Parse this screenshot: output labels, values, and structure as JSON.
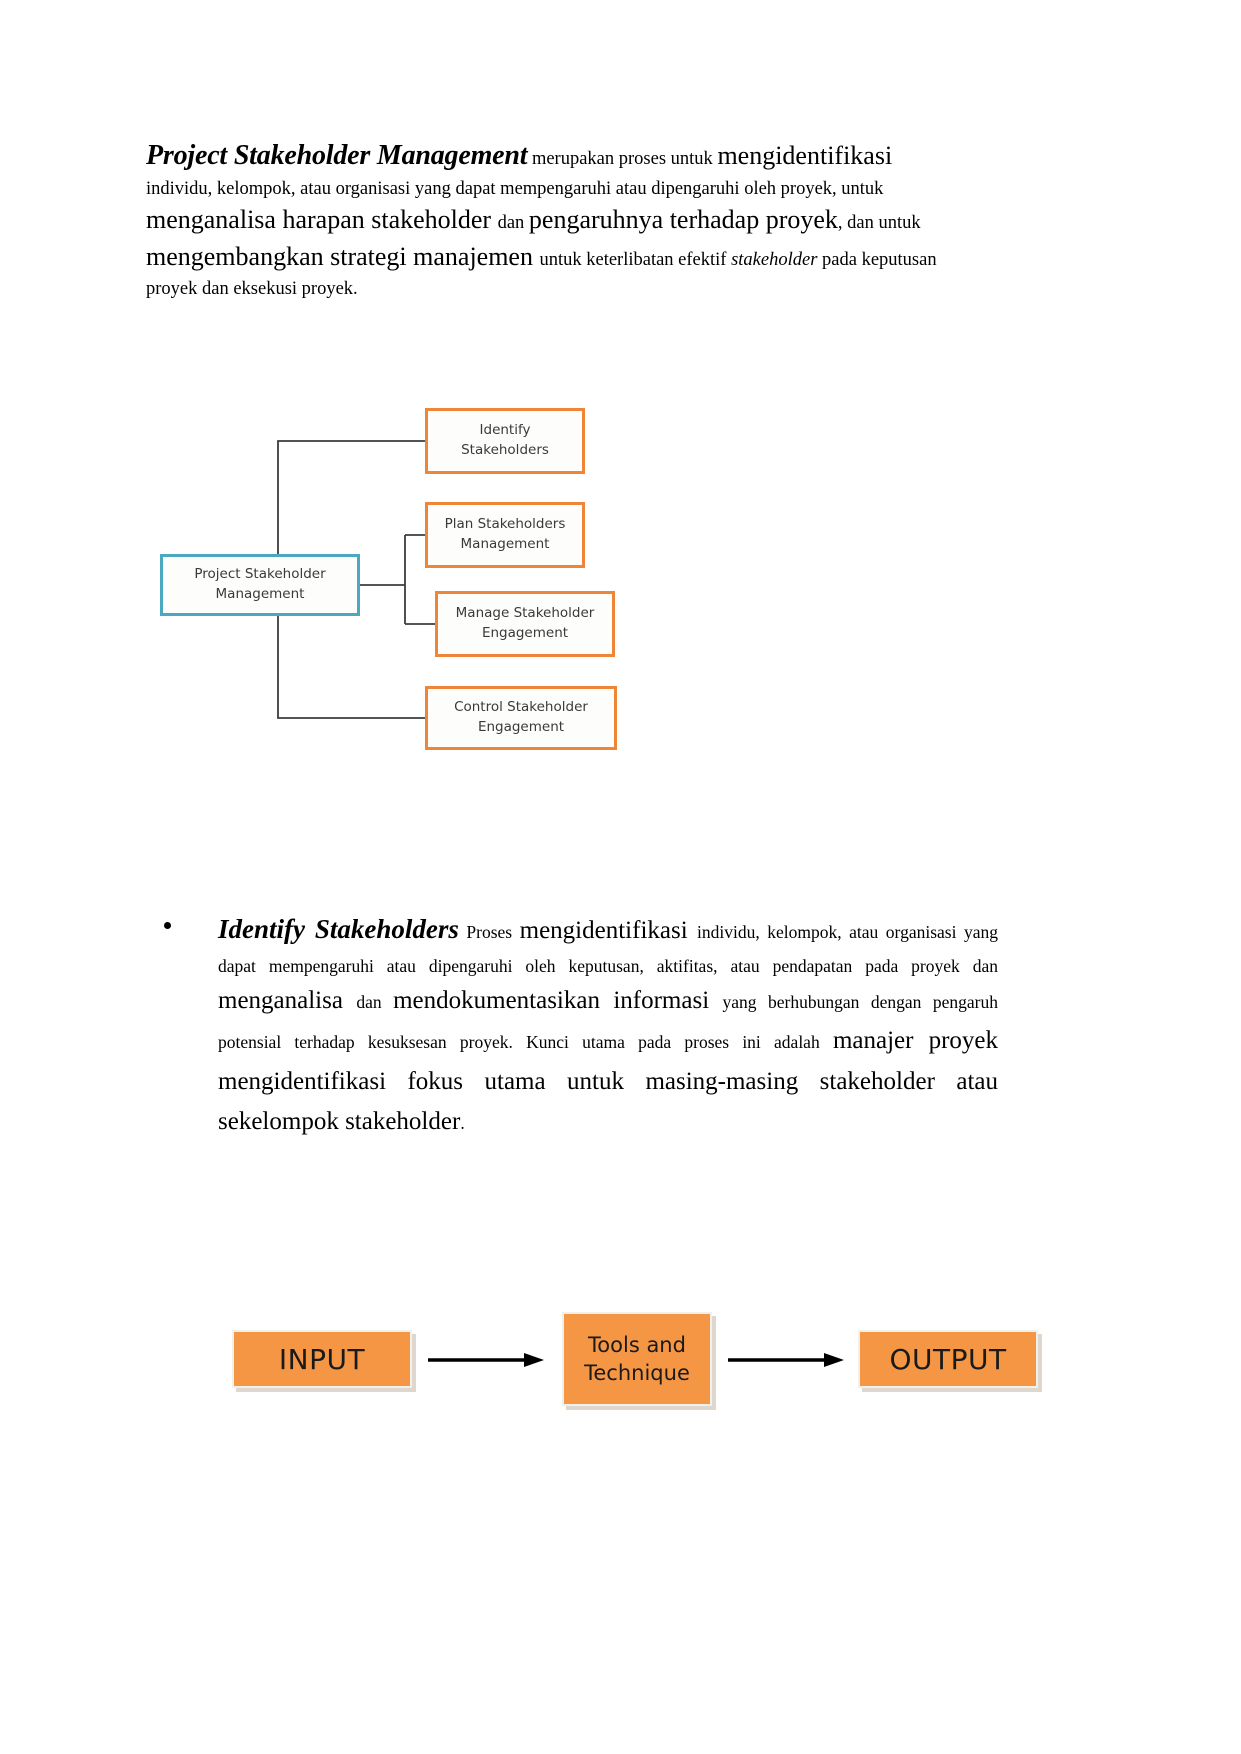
{
  "document": {
    "intro_paragraph": {
      "segments": [
        {
          "text": "Project Stakeholder Management",
          "style": "hero"
        },
        {
          "text": " merupakan proses untuk ",
          "style": "sm"
        },
        {
          "text": "mengidentifikasi ",
          "style": "lg"
        },
        {
          "text": "individu, kelompok, atau organisasi yang dapat mempengaruhi atau dipengaruhi oleh proyek, untuk ",
          "style": "sm"
        },
        {
          "text": "menganalisa harapan stakeholder ",
          "style": "lg"
        },
        {
          "text": "dan ",
          "style": "sm"
        },
        {
          "text": "pengaruhnya terhadap proyek",
          "style": "lg"
        },
        {
          "text": ", dan untuk ",
          "style": "sm"
        },
        {
          "text": "mengembangkan strategi manajemen ",
          "style": "lg"
        },
        {
          "text": "untuk keterlibatan efektif ",
          "style": "sm"
        },
        {
          "text": "stakeholder",
          "style": "it"
        },
        {
          "text": " pada keputusan proyek dan eksekusi proyek.",
          "style": "sm"
        }
      ]
    },
    "org_diagram": {
      "root_label_line1": "Project Stakeholder",
      "root_label_line2": "Management",
      "root_border_color": "#4aa8c0",
      "branch_border_color": "#ef8637",
      "branches": [
        {
          "line1": "Identify",
          "line2": "Stakeholders"
        },
        {
          "line1": "Plan Stakeholders",
          "line2": "Management"
        },
        {
          "line1": "Manage Stakeholder",
          "line2": "Engagement"
        },
        {
          "line1": "Control Stakeholder",
          "line2": "Engagement"
        }
      ]
    },
    "bullet_section": {
      "segments": [
        {
          "text": "Identify Stakeholders",
          "style": "hero"
        },
        {
          "text": " Proses ",
          "style": "sm"
        },
        {
          "text": "mengidentifikasi ",
          "style": "lg"
        },
        {
          "text": "individu, kelompok, atau organisasi yang dapat mempengaruhi atau dipengaruhi oleh keputusan, aktifitas, atau pendapatan pada proyek dan ",
          "style": "sm"
        },
        {
          "text": "menganalisa ",
          "style": "lg"
        },
        {
          "text": "dan ",
          "style": "sm"
        },
        {
          "text": "mendokumentasikan informasi ",
          "style": "lg"
        },
        {
          "text": "yang berhubungan dengan pengaruh potensial terhadap kesuksesan proyek. Kunci utama pada proses ini adalah ",
          "style": "sm"
        },
        {
          "text": "manajer proyek mengidentifikasi fokus utama untuk masing-masing stakeholder atau sekelompok stakeholder",
          "style": "lg"
        },
        {
          "text": ".",
          "style": "sm"
        }
      ]
    },
    "flow_diagram": {
      "box_fill_color": "#f59645",
      "input_label": "INPUT",
      "tools_label_line1": "Tools and",
      "tools_label_line2": "Technique",
      "output_label": "OUTPUT"
    }
  }
}
